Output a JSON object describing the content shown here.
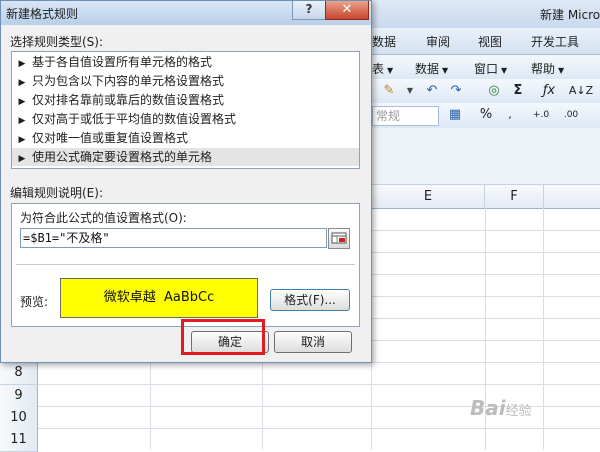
{
  "excel": {
    "window_title": "新建 Micro",
    "ribbon_tabs": [
      "数据",
      "审阅",
      "视图",
      "开发工具"
    ],
    "menus": [
      {
        "label": "表"
      },
      {
        "label": "数据"
      },
      {
        "label": "窗口"
      },
      {
        "label": "帮助"
      }
    ],
    "number_format": "常规",
    "column_headers": [
      "E",
      "F"
    ],
    "row_headers": [
      "8",
      "9",
      "10",
      "11"
    ],
    "watermark": "Bai",
    "watermark_suffix": "经验"
  },
  "dialog": {
    "title": "新建格式规则",
    "help_label": "?",
    "close_label": "✕",
    "rule_type_label": "选择规则类型(S):",
    "rule_types": [
      {
        "label": "基于各自值设置所有单元格的格式",
        "selected": false
      },
      {
        "label": "只为包含以下内容的单元格设置格式",
        "selected": false
      },
      {
        "label": "仅对排名靠前或靠后的数值设置格式",
        "selected": false
      },
      {
        "label": "仅对高于或低于平均值的数值设置格式",
        "selected": false
      },
      {
        "label": "仅对唯一值或重复值设置格式",
        "selected": false
      },
      {
        "label": "使用公式确定要设置格式的单元格",
        "selected": true
      }
    ],
    "edit_description_label": "编辑规则说明(E):",
    "formula_label": "为符合此公式的值设置格式(O):",
    "formula_value": "=$B1=\"不及格\"",
    "preview_label": "预览:",
    "preview_text": "微软卓越  AaBbCc",
    "preview_fill": "#ffff00",
    "format_button": "格式(F)...",
    "ok_button": "确定",
    "cancel_button": "取消",
    "highlight_color": "#e01b24"
  }
}
